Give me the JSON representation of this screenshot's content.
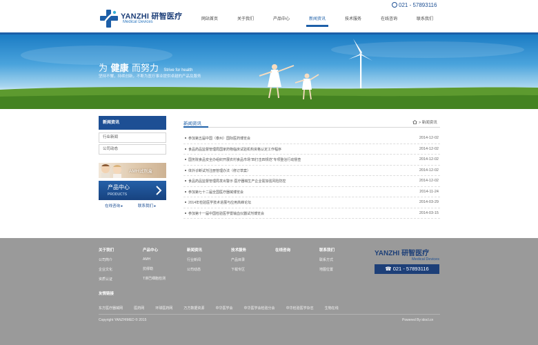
{
  "brand": {
    "logo_text": "YANZHI 研智医疗",
    "logo_sub": "Medical Devices",
    "phone": "021 - 57893116"
  },
  "nav": {
    "items": [
      {
        "label": "网站首页"
      },
      {
        "label": "关于我们"
      },
      {
        "label": "产品中心"
      },
      {
        "label": "新闻资讯"
      },
      {
        "label": "技术服务"
      },
      {
        "label": "在线咨询"
      },
      {
        "label": "联系我们"
      }
    ],
    "active": "新闻资讯"
  },
  "banner": {
    "slogan_pre": "为",
    "slogan_strong": "健康",
    "slogan_post": "而努力",
    "slogan_en": "Strive for health",
    "subtitle": "坚持不懈，持续创新，不断为医疗事业提供卓越的产品及服务"
  },
  "sidebar": {
    "title": "新闻资讯",
    "items": [
      {
        "label": "行业新闻"
      },
      {
        "label": "公司动态"
      }
    ],
    "promo_amh": "AMH试剂盒",
    "promo_products_cn": "产品中心",
    "promo_products_en": "PRODUCTS",
    "btn_consult": "在线咨询 ▸",
    "btn_contact": "联系我们 ▸"
  },
  "main": {
    "title": "新闻资讯",
    "breadcrumb": "> 新闻资讯",
    "news": [
      {
        "title": "参加第五届中国（泰州）国际医药博览会",
        "date": "2014-12-02"
      },
      {
        "title": "食品药品监督管理局国家药物临床试验机构资格认定工作程序",
        "date": "2014-12-02"
      },
      {
        "title": "国务院食品安全办组织开展农村食品市场“四打击四规范”专项整治行动督查",
        "date": "2014-12-02"
      },
      {
        "title": "体外诊断试剂注册管理办法（修订草案）",
        "date": "2014-12-02"
      },
      {
        "title": "食品药品监督管理局发出警示 医疗器械生产企业需加强风险防控",
        "date": "2014-12-02"
      },
      {
        "title": "参加第七十二届全国医疗器械博览会",
        "date": "2014-11-24"
      },
      {
        "title": "2014年检验医学技术进展与应用高峰论坛",
        "date": "2014-03-29"
      },
      {
        "title": "参加第十一届中国检验医学暨输血仪器试剂博览会",
        "date": "2014-03-15"
      }
    ]
  },
  "footer": {
    "columns": [
      {
        "heading": "关于我们",
        "links": [
          "公司简介",
          "企业文化",
          "资质认证"
        ]
      },
      {
        "heading": "产品中心",
        "links": [
          "AMH",
          "抗缪勒",
          "T淋巴细胞检测"
        ]
      },
      {
        "heading": "新闻资讯",
        "links": [
          "行业新闻",
          "公司动态"
        ]
      },
      {
        "heading": "技术服务",
        "links": [
          "产品目录",
          "下载专区"
        ]
      },
      {
        "heading": "在线咨询",
        "links": []
      },
      {
        "heading": "联系我们",
        "links": [
          "联系方式",
          "地图位置"
        ]
      }
    ],
    "logo_text": "YANZHI 研智医疗",
    "logo_sub": "Medical Devices",
    "phone": "021 - 57893116",
    "links_title": "友情链接",
    "friend_links": [
      "东方医疗器械网",
      "医药网",
      "环球医药网",
      "万方数据资源",
      "中华医学会",
      "中华医学会检验分会",
      "中华检验医学杂志",
      "生物在线"
    ],
    "copyright": "Copyright YANZHIMED © 2015",
    "powered": "Powered By idocl.cn"
  },
  "colors": {
    "primary": "#1d5fa8",
    "navy": "#1d3f78",
    "footer_bg": "#9a9a9a"
  },
  "icons": [
    "medical-cross-logo-icon",
    "phone-icon",
    "home-icon",
    "chevron-right-icon"
  ]
}
